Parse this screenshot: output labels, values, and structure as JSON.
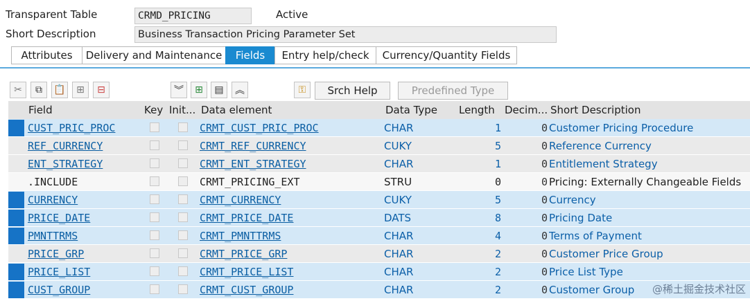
{
  "header": {
    "type_label": "Transparent Table",
    "table_name": "CRMD_PRICING",
    "status": "Active",
    "short_desc_label": "Short Description",
    "short_desc_value": "Business Transaction Pricing Parameter Set"
  },
  "tabs": [
    {
      "label": "Attributes",
      "active": false
    },
    {
      "label": "Delivery and Maintenance",
      "active": false
    },
    {
      "label": "Fields",
      "active": true
    },
    {
      "label": "Entry help/check",
      "active": false
    },
    {
      "label": "Currency/Quantity Fields",
      "active": false
    }
  ],
  "toolbar": {
    "icons": [
      "cut-icon",
      "copy-icon",
      "paste-icon",
      "insert-row-icon",
      "delete-row-icon",
      "collapse-all-icon",
      "new-field-icon",
      "details-icon",
      "expand-all-icon",
      "search-help-key-icon"
    ],
    "srch_help_label": "Srch Help",
    "predefined_type_label": "Predefined Type"
  },
  "table": {
    "columns": {
      "field": "Field",
      "key": "Key",
      "init": "Init...",
      "data_element": "Data element",
      "data_type": "Data Type",
      "length": "Length",
      "decimals": "Decim...",
      "short_description": "Short Description"
    },
    "rows": [
      {
        "field": "CUST_PRIC_PROC",
        "data_element": "CRMT_CUST_PRIC_PROC",
        "data_type": "CHAR",
        "length": "1",
        "decimals": "0",
        "description": "Customer Pricing Procedure",
        "selected": true,
        "include": false
      },
      {
        "field": "REF_CURRENCY",
        "data_element": "CRMT_REF_CURRENCY",
        "data_type": "CUKY",
        "length": "5",
        "decimals": "0",
        "description": "Reference Currency",
        "selected": false,
        "include": false
      },
      {
        "field": "ENT_STRATEGY",
        "data_element": "CRMT_ENT_STRATEGY",
        "data_type": "CHAR",
        "length": "1",
        "decimals": "0",
        "description": "Entitlement Strategy",
        "selected": false,
        "include": false
      },
      {
        "field": ".INCLUDE",
        "data_element": "CRMT_PRICING_EXT",
        "data_type": "STRU",
        "length": "0",
        "decimals": "0",
        "description": "Pricing: Externally Changeable Fields",
        "selected": false,
        "include": true
      },
      {
        "field": "CURRENCY",
        "data_element": "CRMT_CURRENCY",
        "data_type": "CUKY",
        "length": "5",
        "decimals": "0",
        "description": "Currency",
        "selected": true,
        "include": false
      },
      {
        "field": "PRICE_DATE",
        "data_element": "CRMT_PRICE_DATE",
        "data_type": "DATS",
        "length": "8",
        "decimals": "0",
        "description": "Pricing Date",
        "selected": true,
        "include": false
      },
      {
        "field": "PMNTTRMS",
        "data_element": "CRMT_PMNTTRMS",
        "data_type": "CHAR",
        "length": "4",
        "decimals": "0",
        "description": "Terms of Payment",
        "selected": true,
        "include": false
      },
      {
        "field": "PRICE_GRP",
        "data_element": "CRMT_PRICE_GRP",
        "data_type": "CHAR",
        "length": "2",
        "decimals": "0",
        "description": "Customer Price Group",
        "selected": false,
        "include": false
      },
      {
        "field": "PRICE_LIST",
        "data_element": "CRMT_PRICE_LIST",
        "data_type": "CHAR",
        "length": "2",
        "decimals": "0",
        "description": "Price List Type",
        "selected": true,
        "include": false
      },
      {
        "field": "CUST_GROUP",
        "data_element": "CRMT_CUST_GROUP",
        "data_type": "CHAR",
        "length": "2",
        "decimals": "0",
        "description": "Customer Group",
        "selected": true,
        "include": false
      }
    ]
  },
  "watermark": "@稀土掘金技术社区",
  "colors": {
    "accent": "#1a8ad0",
    "row_selected": "#d4e8f7",
    "row_normal": "#eaeaea",
    "row_include": "#f7f7f7",
    "selector_marker": "#1673c6",
    "link": "#0a5ea3"
  }
}
